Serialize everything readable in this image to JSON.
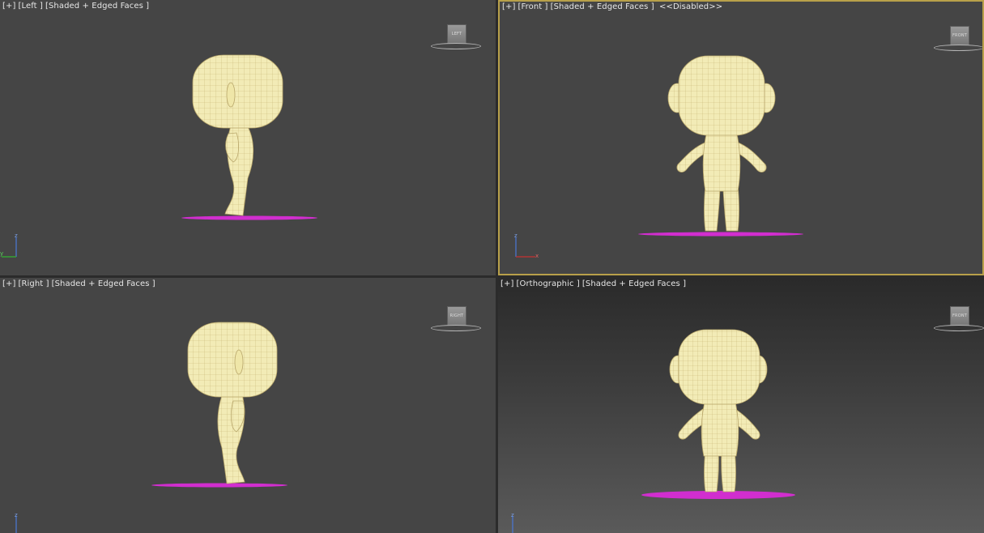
{
  "viewports": {
    "top_left": {
      "menu": "[+]",
      "view": "[Left ]",
      "shading": "[Shaded + Edged Faces ]",
      "status": "",
      "viewcube": "LEFT"
    },
    "top_right": {
      "menu": "[+]",
      "view": "[Front ]",
      "shading": "[Shaded + Edged Faces ]",
      "status": "<<Disabled>>",
      "viewcube": "FRONT"
    },
    "bottom_left": {
      "menu": "[+]",
      "view": "[Right ]",
      "shading": "[Shaded + Edged Faces ]",
      "status": "",
      "viewcube": "RIGHT"
    },
    "bottom_right": {
      "menu": "[+]",
      "view": "[Orthographic ]",
      "shading": "[Shaded + Edged Faces ]",
      "status": "",
      "viewcube": "FRONT"
    }
  },
  "axes": {
    "z": "z",
    "y": "y",
    "x": "x"
  },
  "colors": {
    "model": "#f2ebb6",
    "wire": "#c9b878",
    "ground": "#d12ecf",
    "active_border": "#b8a04a",
    "axis_x": "#c83232",
    "axis_y": "#32b432",
    "axis_z": "#4a78d8"
  }
}
